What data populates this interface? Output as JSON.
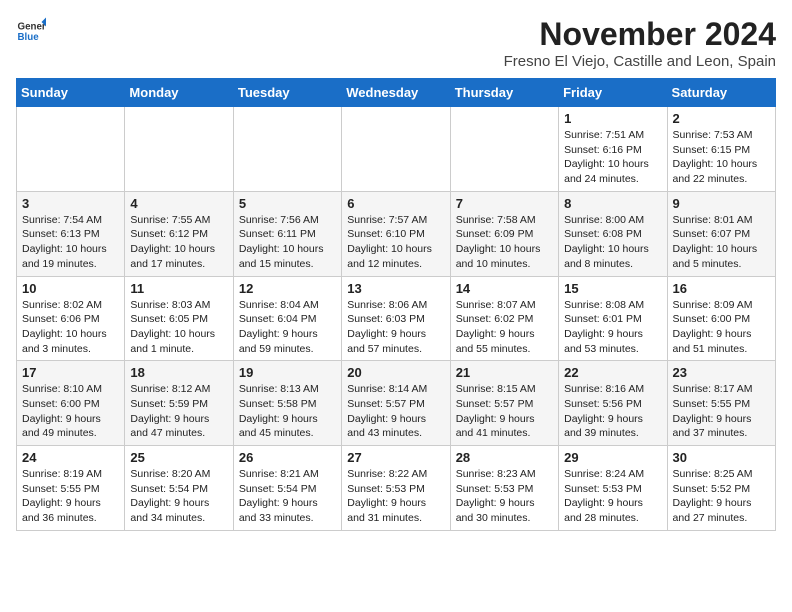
{
  "logo": {
    "general": "General",
    "blue": "Blue"
  },
  "header": {
    "month": "November 2024",
    "location": "Fresno El Viejo, Castille and Leon, Spain"
  },
  "days_of_week": [
    "Sunday",
    "Monday",
    "Tuesday",
    "Wednesday",
    "Thursday",
    "Friday",
    "Saturday"
  ],
  "weeks": [
    [
      {
        "day": "",
        "info": ""
      },
      {
        "day": "",
        "info": ""
      },
      {
        "day": "",
        "info": ""
      },
      {
        "day": "",
        "info": ""
      },
      {
        "day": "",
        "info": ""
      },
      {
        "day": "1",
        "info": "Sunrise: 7:51 AM\nSunset: 6:16 PM\nDaylight: 10 hours and 24 minutes."
      },
      {
        "day": "2",
        "info": "Sunrise: 7:53 AM\nSunset: 6:15 PM\nDaylight: 10 hours and 22 minutes."
      }
    ],
    [
      {
        "day": "3",
        "info": "Sunrise: 7:54 AM\nSunset: 6:13 PM\nDaylight: 10 hours and 19 minutes."
      },
      {
        "day": "4",
        "info": "Sunrise: 7:55 AM\nSunset: 6:12 PM\nDaylight: 10 hours and 17 minutes."
      },
      {
        "day": "5",
        "info": "Sunrise: 7:56 AM\nSunset: 6:11 PM\nDaylight: 10 hours and 15 minutes."
      },
      {
        "day": "6",
        "info": "Sunrise: 7:57 AM\nSunset: 6:10 PM\nDaylight: 10 hours and 12 minutes."
      },
      {
        "day": "7",
        "info": "Sunrise: 7:58 AM\nSunset: 6:09 PM\nDaylight: 10 hours and 10 minutes."
      },
      {
        "day": "8",
        "info": "Sunrise: 8:00 AM\nSunset: 6:08 PM\nDaylight: 10 hours and 8 minutes."
      },
      {
        "day": "9",
        "info": "Sunrise: 8:01 AM\nSunset: 6:07 PM\nDaylight: 10 hours and 5 minutes."
      }
    ],
    [
      {
        "day": "10",
        "info": "Sunrise: 8:02 AM\nSunset: 6:06 PM\nDaylight: 10 hours and 3 minutes."
      },
      {
        "day": "11",
        "info": "Sunrise: 8:03 AM\nSunset: 6:05 PM\nDaylight: 10 hours and 1 minute."
      },
      {
        "day": "12",
        "info": "Sunrise: 8:04 AM\nSunset: 6:04 PM\nDaylight: 9 hours and 59 minutes."
      },
      {
        "day": "13",
        "info": "Sunrise: 8:06 AM\nSunset: 6:03 PM\nDaylight: 9 hours and 57 minutes."
      },
      {
        "day": "14",
        "info": "Sunrise: 8:07 AM\nSunset: 6:02 PM\nDaylight: 9 hours and 55 minutes."
      },
      {
        "day": "15",
        "info": "Sunrise: 8:08 AM\nSunset: 6:01 PM\nDaylight: 9 hours and 53 minutes."
      },
      {
        "day": "16",
        "info": "Sunrise: 8:09 AM\nSunset: 6:00 PM\nDaylight: 9 hours and 51 minutes."
      }
    ],
    [
      {
        "day": "17",
        "info": "Sunrise: 8:10 AM\nSunset: 6:00 PM\nDaylight: 9 hours and 49 minutes."
      },
      {
        "day": "18",
        "info": "Sunrise: 8:12 AM\nSunset: 5:59 PM\nDaylight: 9 hours and 47 minutes."
      },
      {
        "day": "19",
        "info": "Sunrise: 8:13 AM\nSunset: 5:58 PM\nDaylight: 9 hours and 45 minutes."
      },
      {
        "day": "20",
        "info": "Sunrise: 8:14 AM\nSunset: 5:57 PM\nDaylight: 9 hours and 43 minutes."
      },
      {
        "day": "21",
        "info": "Sunrise: 8:15 AM\nSunset: 5:57 PM\nDaylight: 9 hours and 41 minutes."
      },
      {
        "day": "22",
        "info": "Sunrise: 8:16 AM\nSunset: 5:56 PM\nDaylight: 9 hours and 39 minutes."
      },
      {
        "day": "23",
        "info": "Sunrise: 8:17 AM\nSunset: 5:55 PM\nDaylight: 9 hours and 37 minutes."
      }
    ],
    [
      {
        "day": "24",
        "info": "Sunrise: 8:19 AM\nSunset: 5:55 PM\nDaylight: 9 hours and 36 minutes."
      },
      {
        "day": "25",
        "info": "Sunrise: 8:20 AM\nSunset: 5:54 PM\nDaylight: 9 hours and 34 minutes."
      },
      {
        "day": "26",
        "info": "Sunrise: 8:21 AM\nSunset: 5:54 PM\nDaylight: 9 hours and 33 minutes."
      },
      {
        "day": "27",
        "info": "Sunrise: 8:22 AM\nSunset: 5:53 PM\nDaylight: 9 hours and 31 minutes."
      },
      {
        "day": "28",
        "info": "Sunrise: 8:23 AM\nSunset: 5:53 PM\nDaylight: 9 hours and 30 minutes."
      },
      {
        "day": "29",
        "info": "Sunrise: 8:24 AM\nSunset: 5:53 PM\nDaylight: 9 hours and 28 minutes."
      },
      {
        "day": "30",
        "info": "Sunrise: 8:25 AM\nSunset: 5:52 PM\nDaylight: 9 hours and 27 minutes."
      }
    ]
  ]
}
